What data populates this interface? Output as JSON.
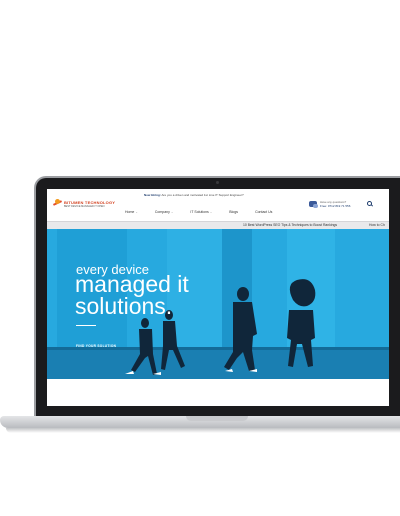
{
  "header": {
    "logo_name": "BITUMEN TECHNOLOGY",
    "logo_tagline": "BEST DEVICE MANAGED IT OPEN",
    "hiring_label": "Now Hiring:",
    "hiring_text": "Are you a driven and motivated 1st Line IT Support Engineer?",
    "nav": [
      {
        "label": "Home",
        "has_menu": true
      },
      {
        "label": "Company",
        "has_menu": true
      },
      {
        "label": "IT Solutions",
        "has_menu": true
      },
      {
        "label": "Blogs",
        "has_menu": false
      },
      {
        "label": "Contact Us",
        "has_menu": false
      }
    ],
    "contact_question": "Have any questions?",
    "contact_phone": "Free: 0712 819 71 556"
  },
  "ticker": {
    "item_1": "10 Best WordPress SEO Tips & Techniques to Boost Rankings",
    "item_2": "How to Ch"
  },
  "hero": {
    "line_1": "every device",
    "line_2": "managed it",
    "line_3": "solutions.",
    "cta": "FIND YOUR SOLUTION"
  },
  "colors": {
    "hero_blue": "#27a9df",
    "brand_orange": "#d2401f",
    "nav_dark": "#1b3a6b",
    "laptop_bezel": "#1b1b1d"
  },
  "icons": {
    "logo": "logo-mark-icon",
    "chat": "chat-bubbles-icon",
    "search": "search-icon",
    "menu_arrow": "chevron-down-icon"
  }
}
